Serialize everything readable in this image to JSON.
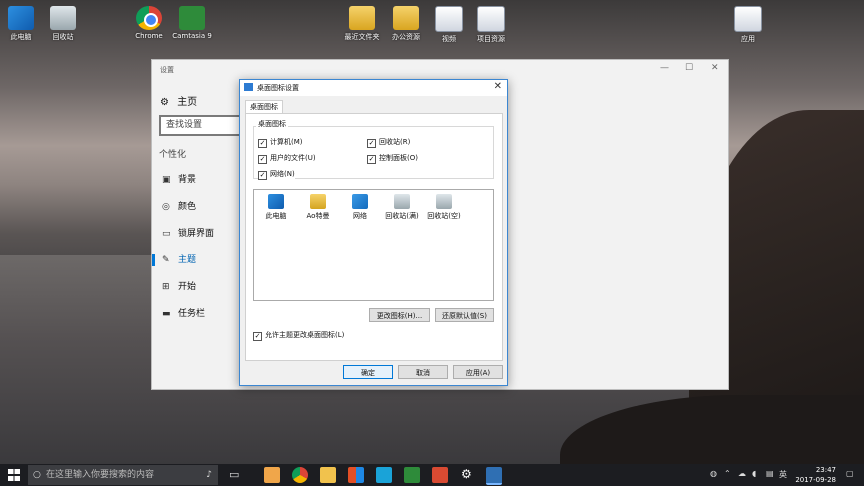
{
  "desktop": {
    "icons": [
      {
        "label": "此电脑",
        "icon": "computer-icon"
      },
      {
        "label": "回收站",
        "icon": "recycle-bin-icon"
      },
      {
        "label": "Chrome",
        "icon": "chrome-icon"
      },
      {
        "label": "Camtasia 9",
        "icon": "camtasia-icon"
      },
      {
        "label": "最近文件夹",
        "icon": "folder-icon"
      },
      {
        "label": "办公资源",
        "icon": "folder-icon"
      },
      {
        "label": "视频",
        "icon": "document-icon"
      },
      {
        "label": "项目资源",
        "icon": "document-icon"
      },
      {
        "label": "应用",
        "icon": "document-icon"
      }
    ]
  },
  "settings": {
    "title": "设置",
    "home": "主页",
    "search_placeholder": "查找设置",
    "section": "个性化",
    "nav": [
      "背景",
      "颜色",
      "锁屏界面",
      "主题",
      "开始",
      "任务栏"
    ],
    "active_nav": "主题"
  },
  "dialog": {
    "title": "桌面图标设置",
    "tab": "桌面图标",
    "group_label": "桌面图标",
    "checkboxes": [
      {
        "label": "计算机(M)",
        "checked": true
      },
      {
        "label": "回收站(R)",
        "checked": true
      },
      {
        "label": "用户的文件(U)",
        "checked": true
      },
      {
        "label": "控制面板(O)",
        "checked": true
      },
      {
        "label": "网络(N)",
        "checked": true
      }
    ],
    "icon_list": [
      "此电脑",
      "Ao特曼",
      "网络",
      "回收站(满)",
      "回收站(空)"
    ],
    "change_icon": "更改图标(H)...",
    "restore_default": "还原默认值(S)",
    "allow_themes": "允许主题更改桌面图标(L)",
    "ok": "确定",
    "cancel": "取消",
    "apply": "应用(A)",
    "close": "✕"
  },
  "taskbar": {
    "search_placeholder": "在这里输入你要搜索的内容",
    "ime": "英",
    "time": "23:47",
    "date": "2017-09-28"
  },
  "colors": {
    "accent": "#0078d7",
    "taskbar": "#1c1d21"
  }
}
